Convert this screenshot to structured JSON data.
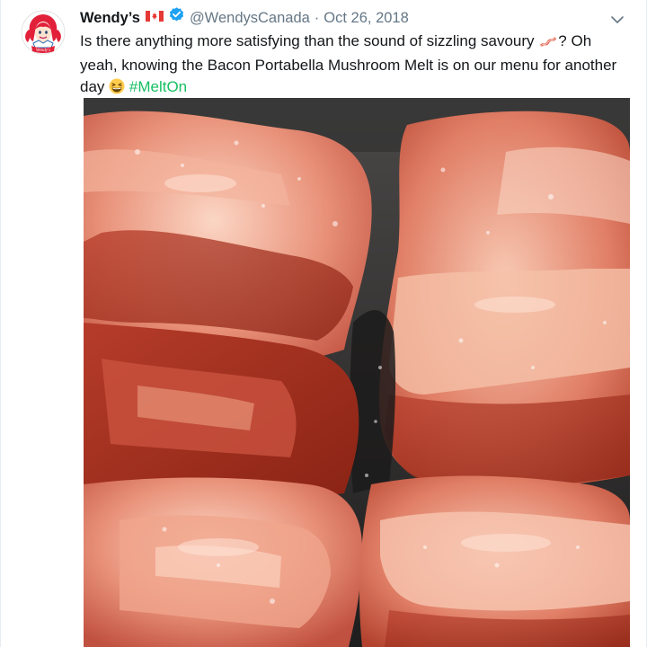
{
  "tweet": {
    "display_name": "Wendy’s",
    "handle": "@WendysCanada",
    "separator": "·",
    "date": "Oct 26, 2018",
    "text_part1": "Is there anything more satisfying than the sound of sizzling savoury",
    "text_part2": "? Oh yeah, knowing the Bacon Portabella Mushroom Melt is on our menu for another day",
    "hashtag": "#MeltOn",
    "avatar_logo_text": "Wendy's",
    "icons": {
      "flag": "canada-flag-icon",
      "verified": "verified-badge-icon",
      "bacon_emoji": "bacon-emoji-icon",
      "laughing_emoji": "grinning-squinting-face-icon",
      "caret": "chevron-down-icon"
    },
    "colors": {
      "hashtag": "#17bf63",
      "verified": "#1da1f2",
      "secondary_text": "#657786"
    }
  }
}
